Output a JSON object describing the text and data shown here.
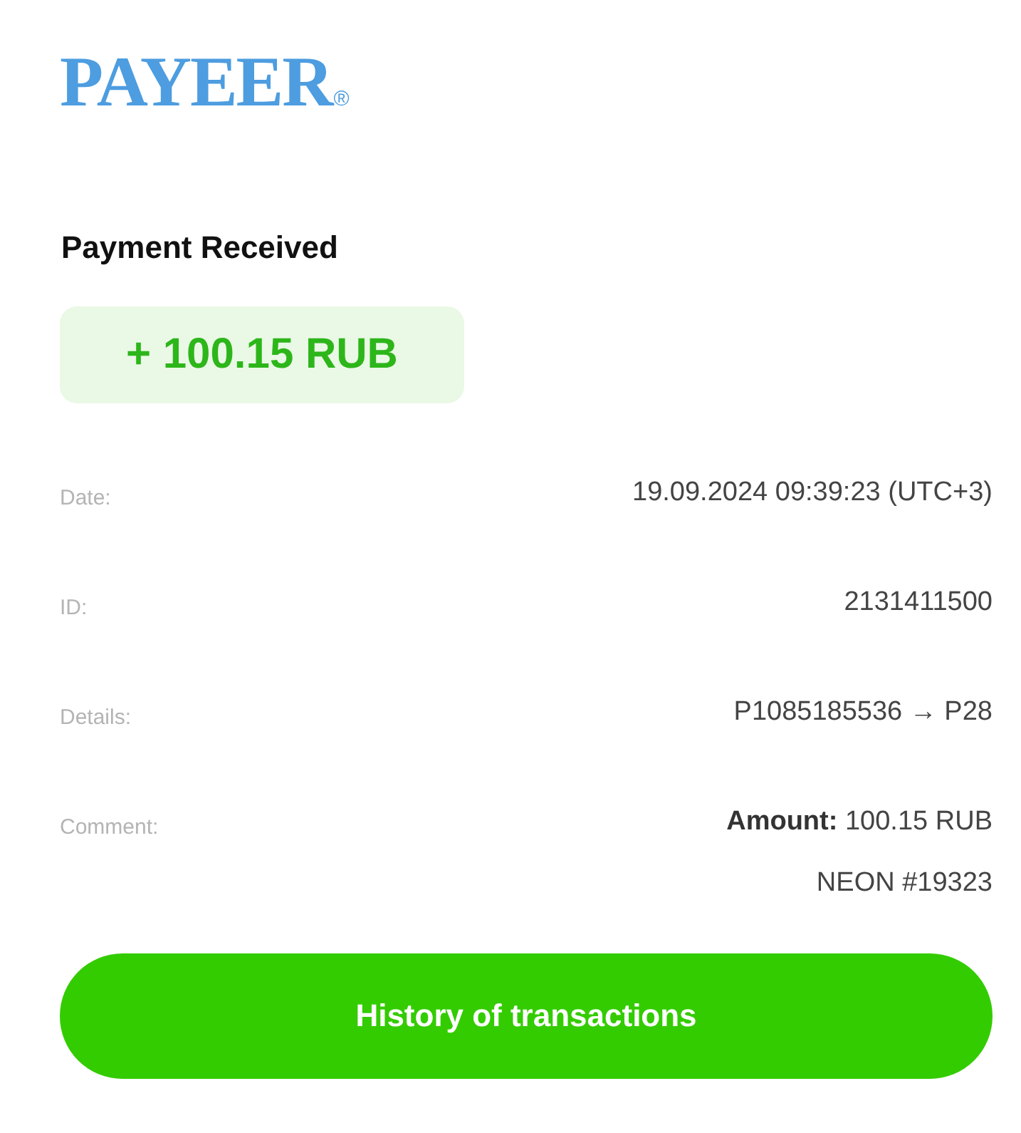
{
  "logo": {
    "text": "PAYEER",
    "mark": "®"
  },
  "title": "Payment Received",
  "amount": "+ 100.15 RUB",
  "fields": [
    {
      "label": "Date:",
      "lines": [
        "19.09.2024 09:39:23 (UTC+3)"
      ]
    },
    {
      "label": "ID:",
      "lines": [
        "2131411500"
      ]
    },
    {
      "label": "Details:",
      "lines": [
        "P1085185536 → P28"
      ]
    },
    {
      "label": "Comment:",
      "lines": [
        "**Amount:** 100.15 RUB",
        "NEON #19323"
      ]
    }
  ],
  "button": "History of transactions"
}
